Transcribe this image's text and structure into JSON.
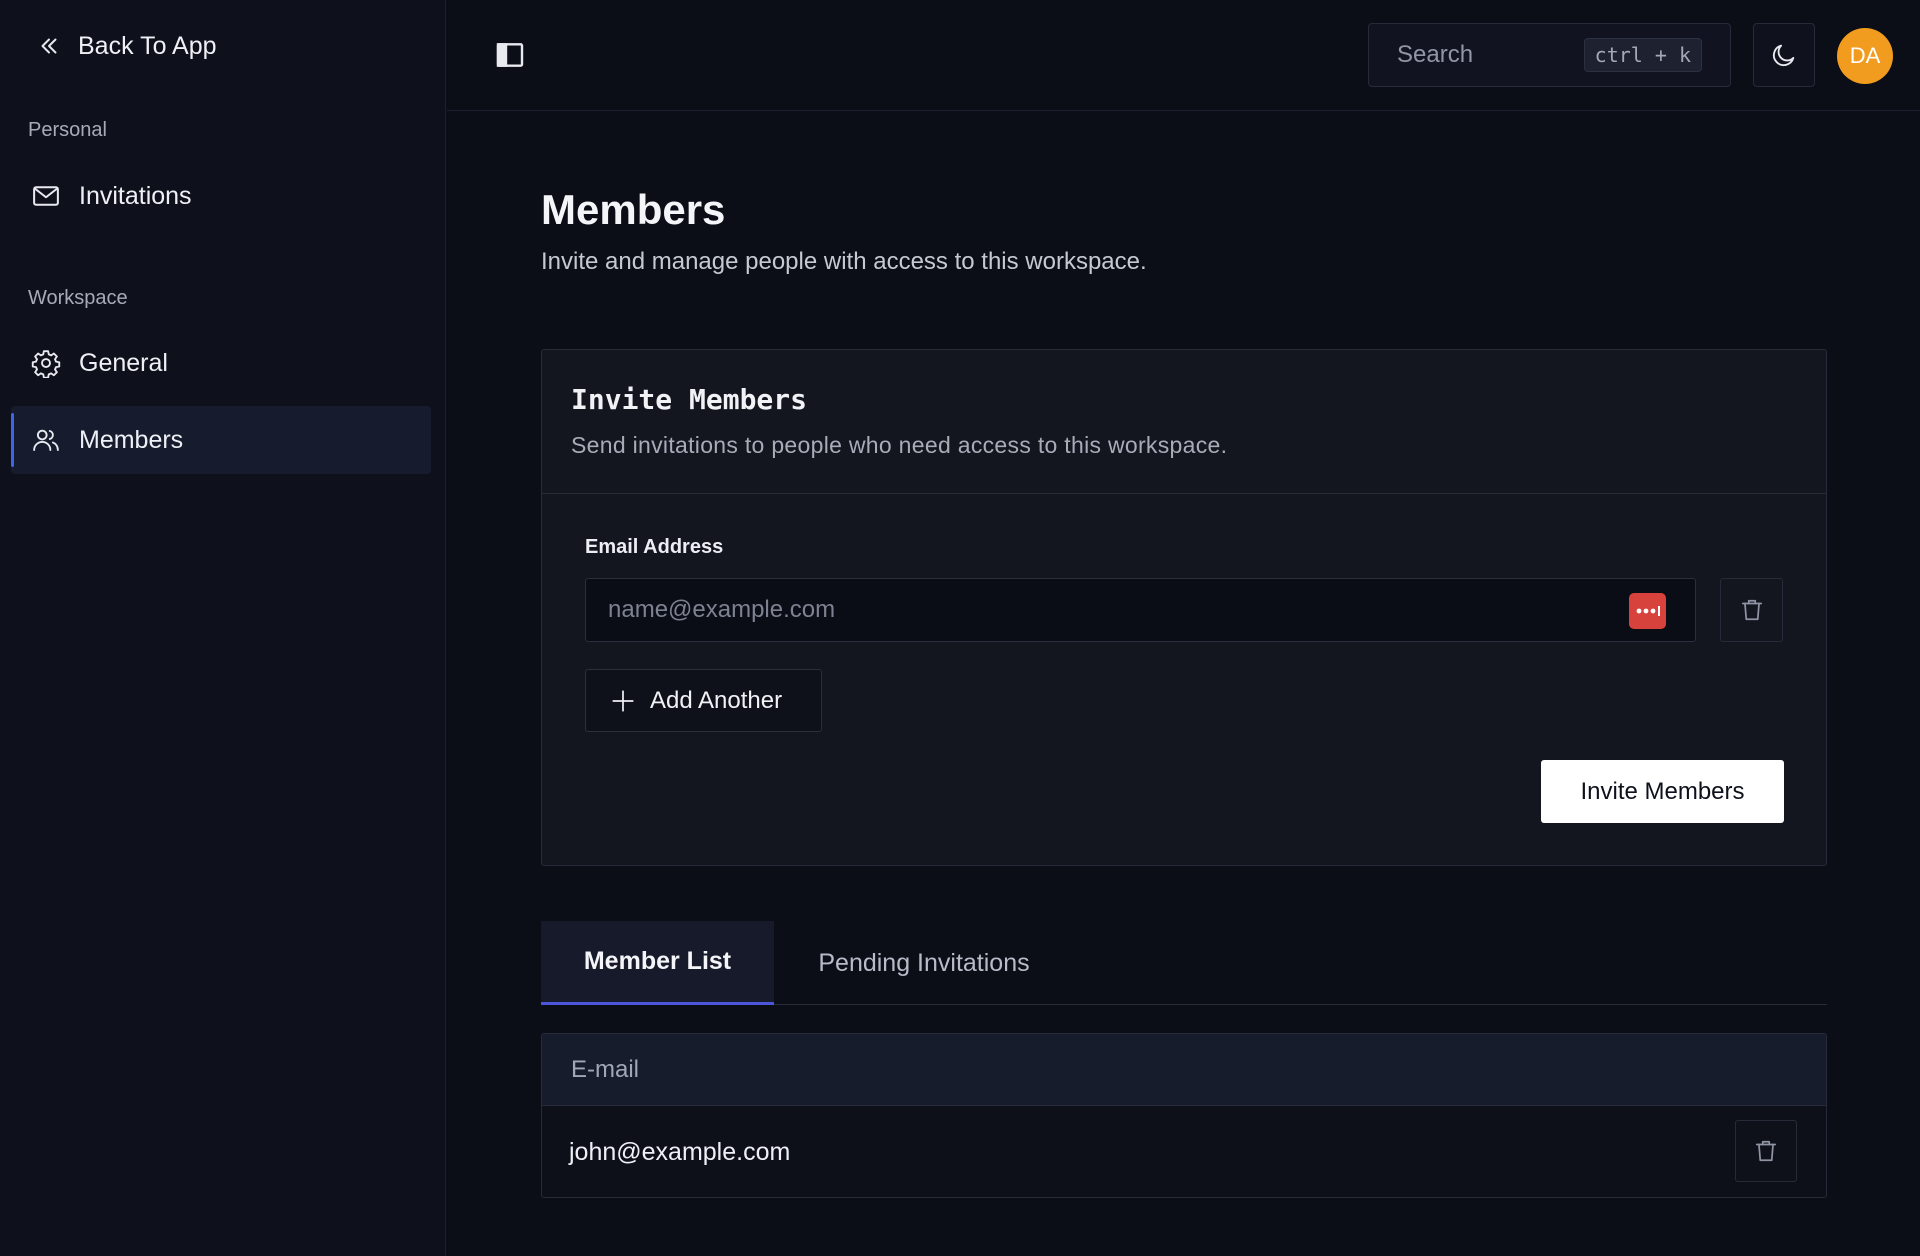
{
  "sidebar": {
    "back_label": "Back To App",
    "personal_label": "Personal",
    "personal_items": [
      {
        "label": "Invitations",
        "icon": "mail-icon"
      }
    ],
    "workspace_label": "Workspace",
    "workspace_items": [
      {
        "label": "General",
        "icon": "gear-icon"
      },
      {
        "label": "Members",
        "icon": "users-icon",
        "active": true
      }
    ]
  },
  "topbar": {
    "search_label": "Search",
    "search_shortcut": "ctrl + k",
    "avatar_initials": "DA"
  },
  "page": {
    "title": "Members",
    "subtitle": "Invite and manage people with access to this workspace."
  },
  "invite_card": {
    "title": "Invite Members",
    "description": "Send invitations to people who need access to this workspace.",
    "email_label": "Email Address",
    "email_placeholder": "name@example.com",
    "email_value": "",
    "add_another_label": "Add Another",
    "submit_label": "Invite Members"
  },
  "tabs": [
    {
      "label": "Member List",
      "active": true
    },
    {
      "label": "Pending Invitations",
      "active": false
    }
  ],
  "member_table": {
    "column_header": "E-mail",
    "rows": [
      {
        "email": "john@example.com"
      }
    ]
  },
  "colors": {
    "background": "#0b0d17",
    "accent": "#4a55d8",
    "avatar": "#f29c1f",
    "password_badge": "#d8423c"
  }
}
